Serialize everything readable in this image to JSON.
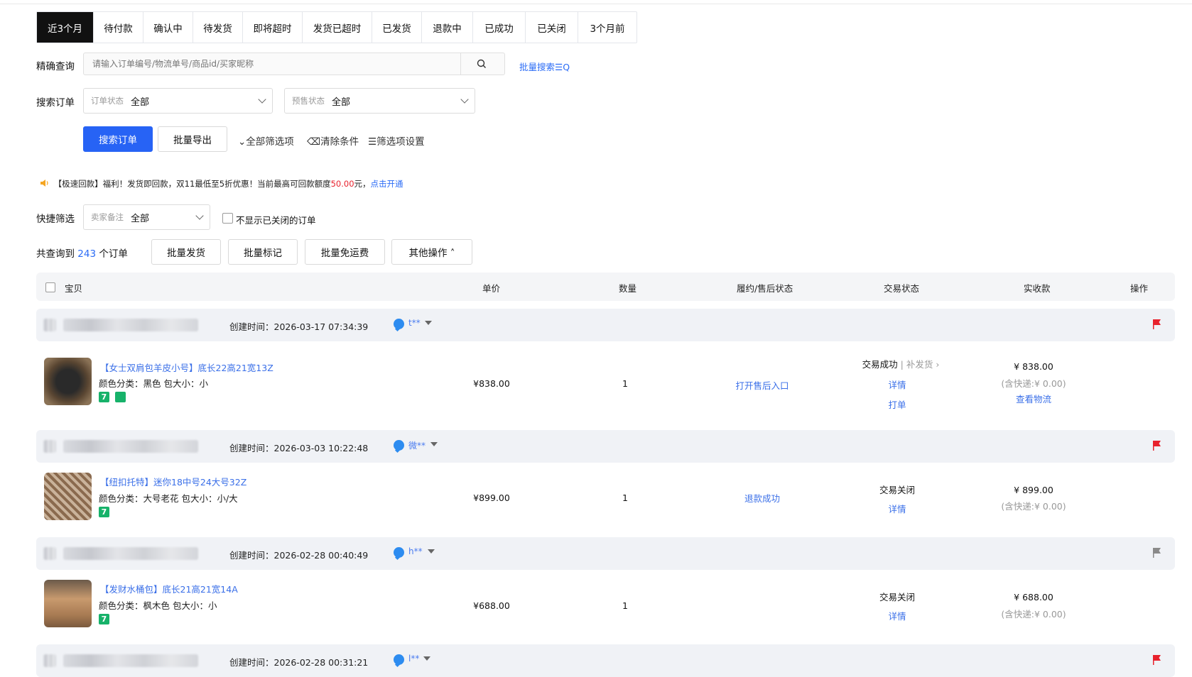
{
  "tabs": [
    "近3个月",
    "待付款",
    "确认中",
    "待发货",
    "即将超时",
    "发货已超时",
    "已发货",
    "退款中",
    "已成功",
    "已关闭",
    "3个月前"
  ],
  "search": {
    "label": "精确查询",
    "placeholder": "请输入订单编号/物流单号/商品id/买家昵称",
    "batch_link": "批量搜索☰Q"
  },
  "filter": {
    "label": "搜索订单",
    "order_status_label": "订单状态",
    "order_status_value": "全部",
    "presale_label": "预售状态",
    "presale_value": "全部"
  },
  "actions": {
    "search_btn": "搜索订单",
    "export_btn": "批量导出",
    "all_filters": "⌄全部筛选项",
    "clear": "⌫清除条件",
    "settings": "☰筛选项设置"
  },
  "notice": {
    "text_a": "【极速回款】福利！发货即回款，双11最低至5折优惠！当前最高可回款额度",
    "amount": "50.00",
    "text_b": "元，",
    "link": "点击开通"
  },
  "quick": {
    "label": "快捷筛选",
    "remark_label": "卖家备注",
    "remark_value": "全部",
    "hide_closed": "不显示已关闭的订单"
  },
  "summary": {
    "prefix": "共查询到",
    "count": "243",
    "suffix": "个订单",
    "btn_ship": "批量发货",
    "btn_mark": "批量标记",
    "btn_free": "批量免运费",
    "btn_other": "其他操作 ˄"
  },
  "table_header": {
    "item": "宝贝",
    "price": "单价",
    "qty": "数量",
    "fulfil": "履约/售后状态",
    "trade": "交易状态",
    "paid": "实收款",
    "op": "操作"
  },
  "orders": [
    {
      "created": "创建时间：2026-03-17 07:34:39",
      "buyer": "t**",
      "title": "【女士双肩包羊皮小号】底长22高21宽13Z",
      "spec": "颜色分类：黑色  包大小：小",
      "price": "¥838.00",
      "qty": "1",
      "fulfil": "打开售后入口",
      "trade": "交易成功",
      "trade_extra": "| 补发货 ›",
      "detail": "详情",
      "print": "打单",
      "paid": "¥ 838.00",
      "shipping": "(含快递:¥ 0.00)",
      "logistics": "查看物流",
      "flag_color": "#e8222d"
    },
    {
      "created": "创建时间：2026-03-03 10:22:48",
      "buyer": "微**",
      "title": "【纽扣托特】迷你18中号24大号32Z",
      "spec": "颜色分类：大号老花  包大小：小/大",
      "price": "¥899.00",
      "qty": "1",
      "fulfil": "退款成功",
      "trade": "交易关闭",
      "detail": "详情",
      "paid": "¥ 899.00",
      "shipping": "(含快递:¥ 0.00)",
      "flag_color": "#e8222d"
    },
    {
      "created": "创建时间：2026-02-28 00:40:49",
      "buyer": "h**",
      "title": "【发财水桶包】底长21高21宽14A",
      "spec": "颜色分类：枫木色  包大小：小",
      "price": "¥688.00",
      "qty": "1",
      "trade": "交易关闭",
      "detail": "详情",
      "paid": "¥ 688.00",
      "shipping": "(含快递:¥ 0.00)",
      "flag_color": "#8a8a8a"
    },
    {
      "created": "创建时间：2026-02-28 00:31:21",
      "buyer": "l**",
      "flag_color": "#e8222d"
    }
  ]
}
